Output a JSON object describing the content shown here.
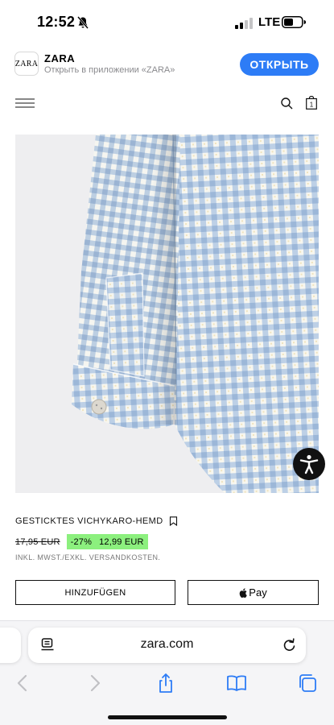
{
  "status_bar": {
    "time": "12:52",
    "network": "LTE",
    "icons": [
      "bell-muted-icon",
      "signal-icon",
      "battery-icon"
    ]
  },
  "app_banner": {
    "logo": "ZARA",
    "name": "ZARA",
    "subtitle": "Открыть в приложении «ZARA»",
    "open_label": "ОТКРЫТЬ",
    "accent_color": "#2d7cf6"
  },
  "header": {
    "icons": [
      "menu-icon",
      "search-icon",
      "shopping-bag-icon"
    ],
    "bag_count": "1"
  },
  "product": {
    "image_subject": "light blue and white gingham shirt sleeve with cuff button",
    "title": "GESTICKTES VICHYKARO-HEMD",
    "old_price": "17,95 EUR",
    "discount": "-27%",
    "price": "12,99 EUR",
    "discount_highlight_color": "#8cf07e",
    "tax_note": "INKL. MWST./EXKL. VERSANDKOSTEN.",
    "add_button": "HINZUFÜGEN",
    "pay_button": "Pay"
  },
  "browser": {
    "address": "zara.com",
    "toolbar_icons": [
      "back-icon",
      "forward-icon",
      "share-icon",
      "bookmarks-icon",
      "tabs-icon"
    ]
  }
}
